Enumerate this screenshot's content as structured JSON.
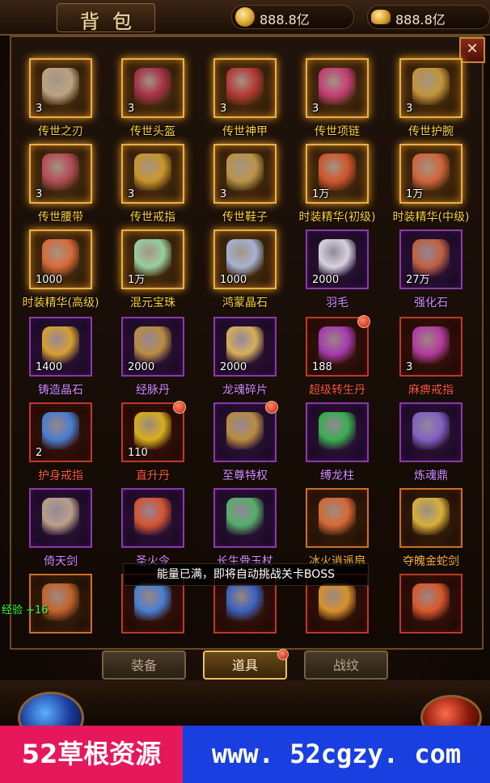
{
  "header": {
    "title": "背包",
    "currency": [
      {
        "icon": "gold-coin-icon",
        "value": "888.8亿"
      },
      {
        "icon": "gold-ingot-icon",
        "value": "888.8亿"
      }
    ],
    "close_icon": "close-icon",
    "close_label": "✕"
  },
  "items": [
    {
      "name": "传世之刃",
      "count": "3",
      "frame": "gold",
      "art": "#c8b090"
    },
    {
      "name": "传世头盔",
      "count": "3",
      "frame": "gold",
      "art": "#b03050"
    },
    {
      "name": "传世神甲",
      "count": "3",
      "frame": "gold",
      "art": "#c03a3a"
    },
    {
      "name": "传世项链",
      "count": "3",
      "frame": "gold",
      "art": "#d04080"
    },
    {
      "name": "传世护腕",
      "count": "3",
      "frame": "gold",
      "art": "#d0a040"
    },
    {
      "name": "传世腰带",
      "count": "3",
      "frame": "gold",
      "art": "#c05060"
    },
    {
      "name": "传世戒指",
      "count": "3",
      "frame": "gold",
      "art": "#d8a030"
    },
    {
      "name": "传世鞋子",
      "count": "3",
      "frame": "gold",
      "art": "#c8a050"
    },
    {
      "name": "时装精华(初级)",
      "count": "1万",
      "frame": "gold",
      "art": "#e05a30"
    },
    {
      "name": "时装精华(中级)",
      "count": "1万",
      "frame": "gold",
      "art": "#e06a40"
    },
    {
      "name": "时装精华(高级)",
      "count": "1000",
      "frame": "gold",
      "art": "#e87040"
    },
    {
      "name": "混元宝珠",
      "count": "1万",
      "frame": "gold",
      "art": "#a0e0b0"
    },
    {
      "name": "鸿蒙晶石",
      "count": "1000",
      "frame": "gold",
      "art": "#b0c0e8"
    },
    {
      "name": "羽毛",
      "count": "2000",
      "frame": "purple",
      "art": "#e8e8f0"
    },
    {
      "name": "强化石",
      "count": "27万",
      "frame": "purple",
      "art": "#d06a40"
    },
    {
      "name": "铸造晶石",
      "count": "1400",
      "frame": "purple",
      "art": "#e8b030"
    },
    {
      "name": "经脉丹",
      "count": "2000",
      "frame": "purple",
      "art": "#c89a40"
    },
    {
      "name": "龙魂碎片",
      "count": "2000",
      "frame": "purple",
      "art": "#e8c060"
    },
    {
      "name": "超级转生丹",
      "count": "188",
      "frame": "red",
      "art": "#b040c0",
      "dot": true
    },
    {
      "name": "麻痹戒指",
      "count": "3",
      "frame": "red",
      "art": "#c040b0"
    },
    {
      "name": "护身戒指",
      "count": "2",
      "frame": "red",
      "art": "#4a8ae8"
    },
    {
      "name": "直升丹",
      "count": "110",
      "frame": "red",
      "art": "#e8c020",
      "dot": true
    },
    {
      "name": "至尊特权",
      "count": "",
      "frame": "purple",
      "art": "#c89a40",
      "dot": true
    },
    {
      "name": "缚龙柱",
      "count": "",
      "frame": "purple",
      "art": "#3ac050"
    },
    {
      "name": "炼魂鼎",
      "count": "",
      "frame": "purple",
      "art": "#8a6ad0"
    },
    {
      "name": "倚天剑",
      "count": "",
      "frame": "purple",
      "art": "#c8b090"
    },
    {
      "name": "圣火令",
      "count": "",
      "frame": "purple",
      "art": "#e85a30"
    },
    {
      "name": "长生骨玉杖",
      "count": "",
      "frame": "purple",
      "art": "#5ac070"
    },
    {
      "name": "冰火逍遥扇",
      "count": "",
      "frame": "orange",
      "art": "#e8703a"
    },
    {
      "name": "夺魄金蛇剑",
      "count": "",
      "frame": "orange",
      "art": "#e8c040"
    },
    {
      "name": "",
      "count": "",
      "frame": "orange",
      "art": "#d06a30"
    },
    {
      "name": "",
      "count": "",
      "frame": "red",
      "art": "#4a8ae8"
    },
    {
      "name": "",
      "count": "",
      "frame": "red",
      "art": "#3a6ad0"
    },
    {
      "name": "",
      "count": "",
      "frame": "red",
      "art": "#e8a030"
    },
    {
      "name": "",
      "count": "",
      "frame": "red",
      "art": "#e86030"
    }
  ],
  "toast": "能量已满，即将自动挑战关卡BOSS",
  "exp_text": "经验 +16",
  "tabs": [
    {
      "label": "装备",
      "active": false
    },
    {
      "label": "道具",
      "active": true,
      "dot": true
    },
    {
      "label": "战纹",
      "active": false
    }
  ],
  "banner": {
    "left": "52草根资源",
    "right": "www. 52cgzy. com",
    "left_color": "#e6175a",
    "right_color": "#1a3fe0"
  }
}
